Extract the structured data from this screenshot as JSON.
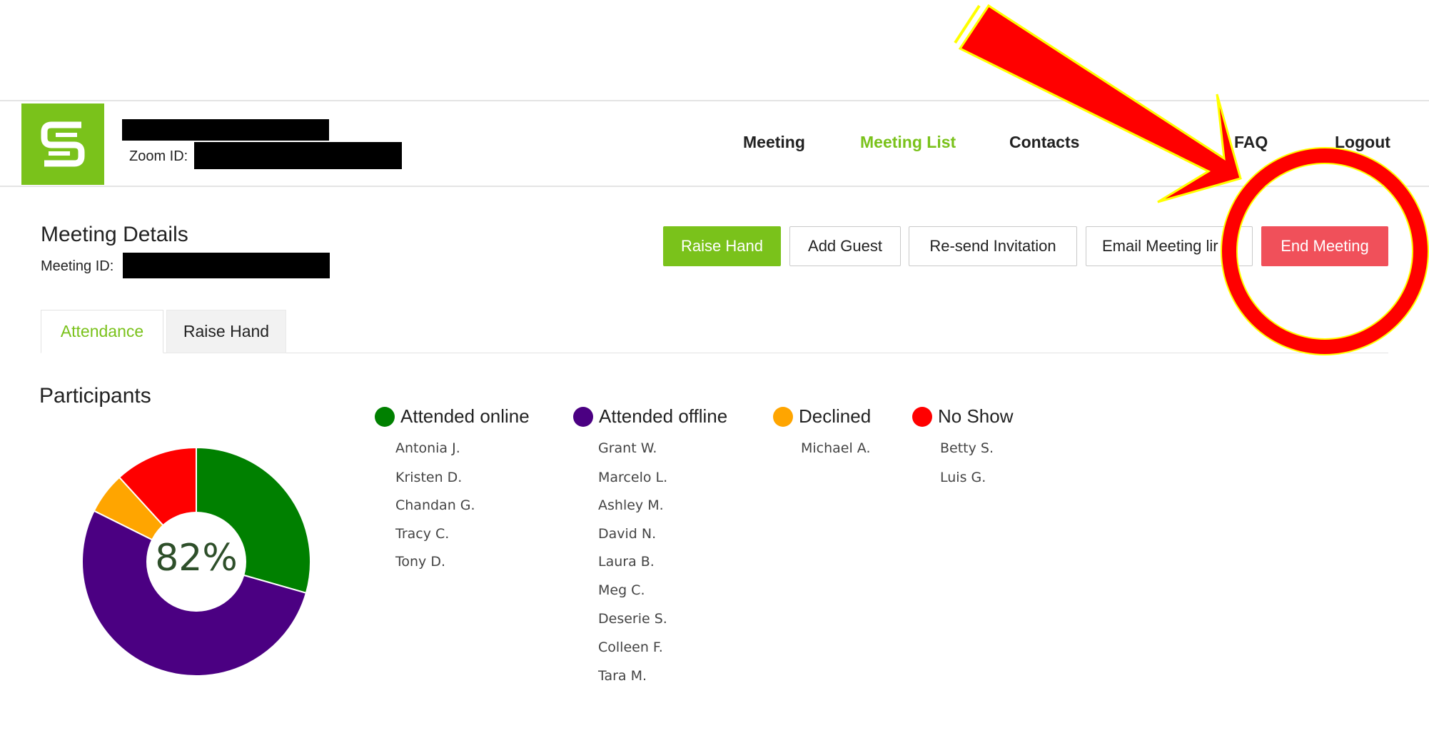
{
  "header": {
    "zoom_label": "Zoom ID:",
    "nav": [
      "Meeting",
      "Meeting List",
      "Contacts",
      "FAQ",
      "Logout"
    ],
    "active_nav": "Meeting List"
  },
  "meeting": {
    "title": "Meeting Details",
    "id_label": "Meeting ID:"
  },
  "actions": {
    "raise_hand": "Raise Hand",
    "add_guest": "Add Guest",
    "resend": "Re-send Invitation",
    "email_link": "Email Meeting lir",
    "end_meeting": "End Meeting"
  },
  "tabs": [
    "Attendance",
    "Raise Hand"
  ],
  "participants": {
    "title": "Participants",
    "percent": "82%",
    "groups": [
      {
        "label": "Attended online",
        "color": "#008000",
        "names": [
          "Antonia J.",
          "Kristen D.",
          "Chandan G.",
          "Tracy C.",
          "Tony D."
        ]
      },
      {
        "label": "Attended offline",
        "color": "#4b0082",
        "names": [
          "Grant W.",
          "Marcelo L.",
          "Ashley M.",
          "David N.",
          "Laura B.",
          "Meg C.",
          "Deserie S.",
          "Colleen F.",
          "Tara M."
        ]
      },
      {
        "label": "Declined",
        "color": "#ffa500",
        "names": [
          "Michael A."
        ]
      },
      {
        "label": "No Show",
        "color": "#ff0000",
        "names": [
          "Betty S.",
          "Luis G."
        ]
      }
    ]
  },
  "chart_data": {
    "type": "pie",
    "categories": [
      "Attended online",
      "Attended offline",
      "Declined",
      "No Show"
    ],
    "values": [
      5,
      9,
      1,
      2
    ],
    "colors": [
      "#008000",
      "#4b0082",
      "#ffa500",
      "#ff0000"
    ],
    "center_label": "82%"
  },
  "annotation_colors": {
    "arrow": "#ff0000",
    "outline": "#ffff00"
  }
}
